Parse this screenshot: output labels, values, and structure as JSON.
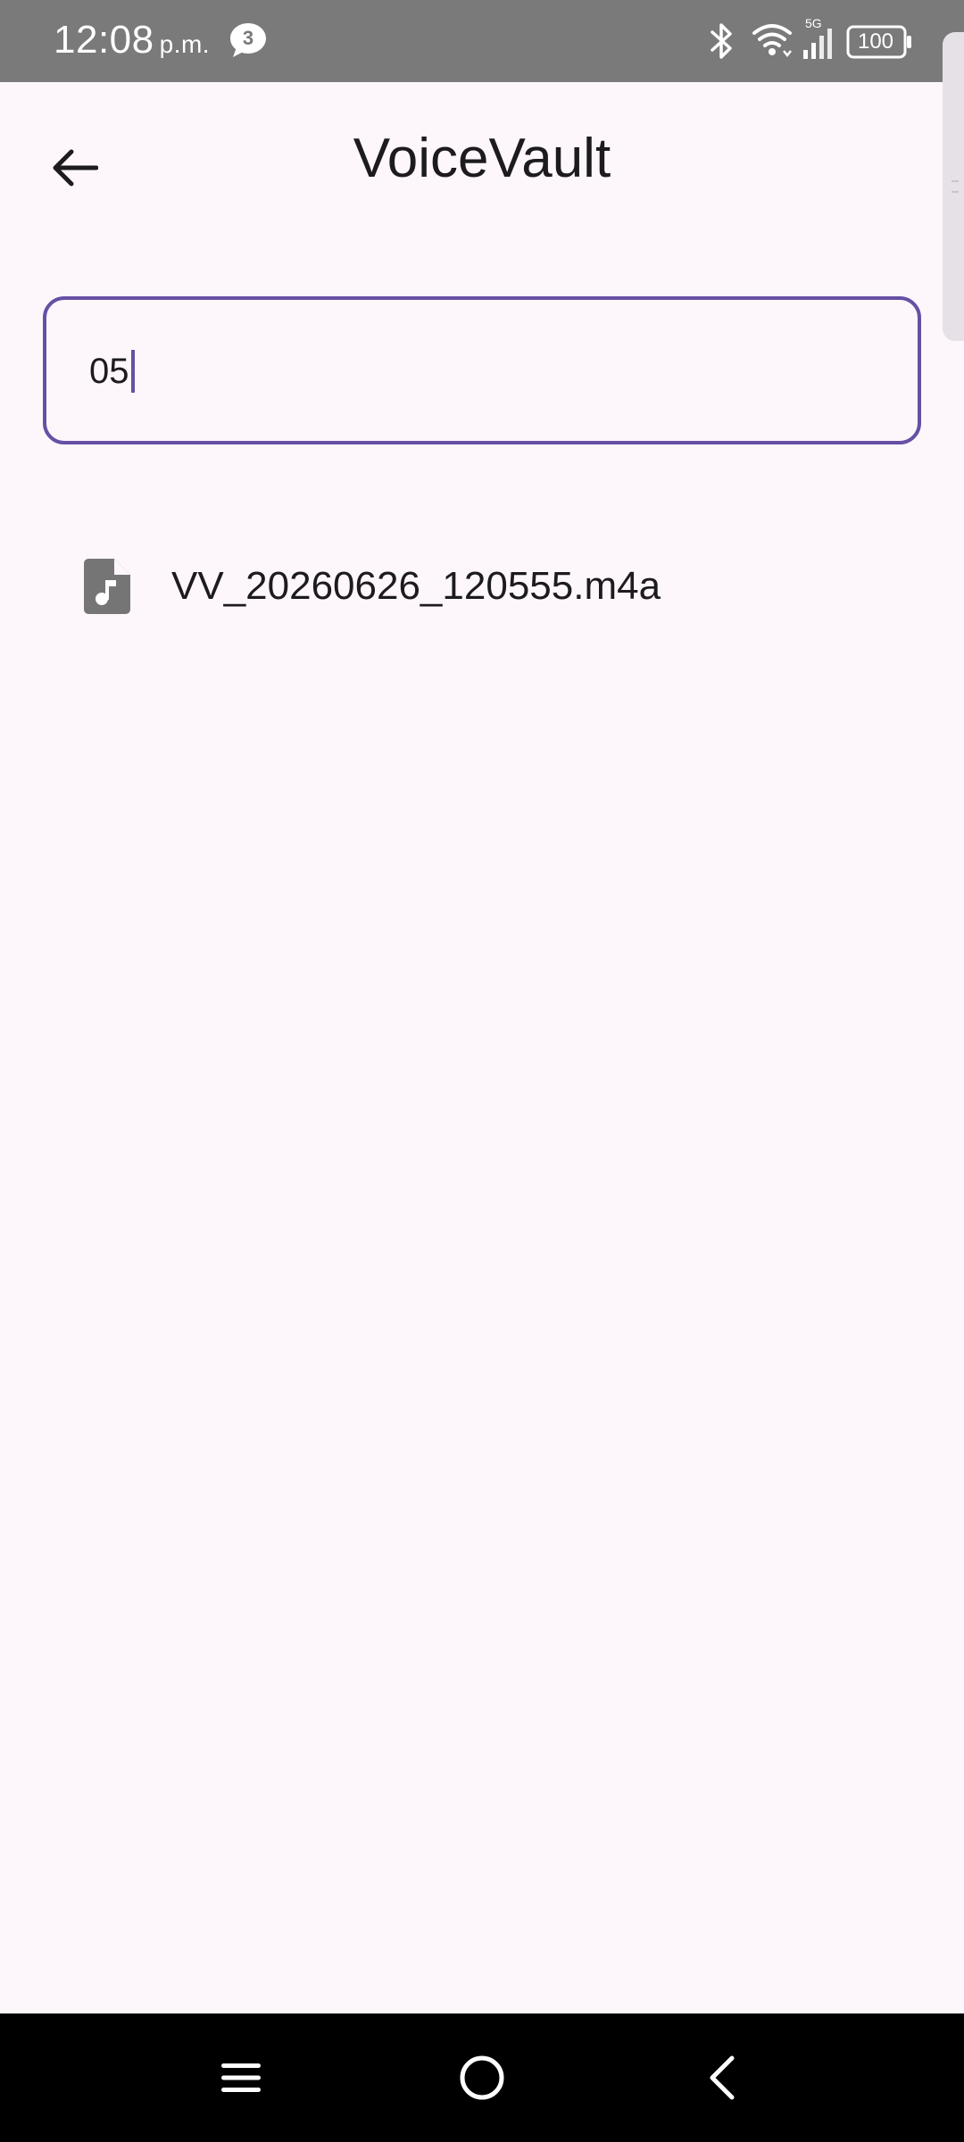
{
  "status_bar": {
    "time": "12:08",
    "ampm": "p.m.",
    "notification_count": "3",
    "network_label": "5G",
    "battery": "100",
    "icons": [
      "chat-notification-icon",
      "bluetooth-icon",
      "wifi-icon",
      "signal-icon",
      "battery-icon"
    ]
  },
  "app_bar": {
    "title": "VoiceVault",
    "back_icon": "arrow-left-icon"
  },
  "search": {
    "value": "05"
  },
  "results": [
    {
      "icon": "audio-file-icon",
      "name": "VV_20260626_120555.m4a"
    }
  ],
  "nav_bar": {
    "icons": [
      "menu-icon",
      "home-icon",
      "back-chevron-icon"
    ]
  },
  "colors": {
    "accent": "#6750a4",
    "background": "#fdf7fc",
    "status_bar": "#7a7a7a",
    "icon_gray": "#757575"
  }
}
